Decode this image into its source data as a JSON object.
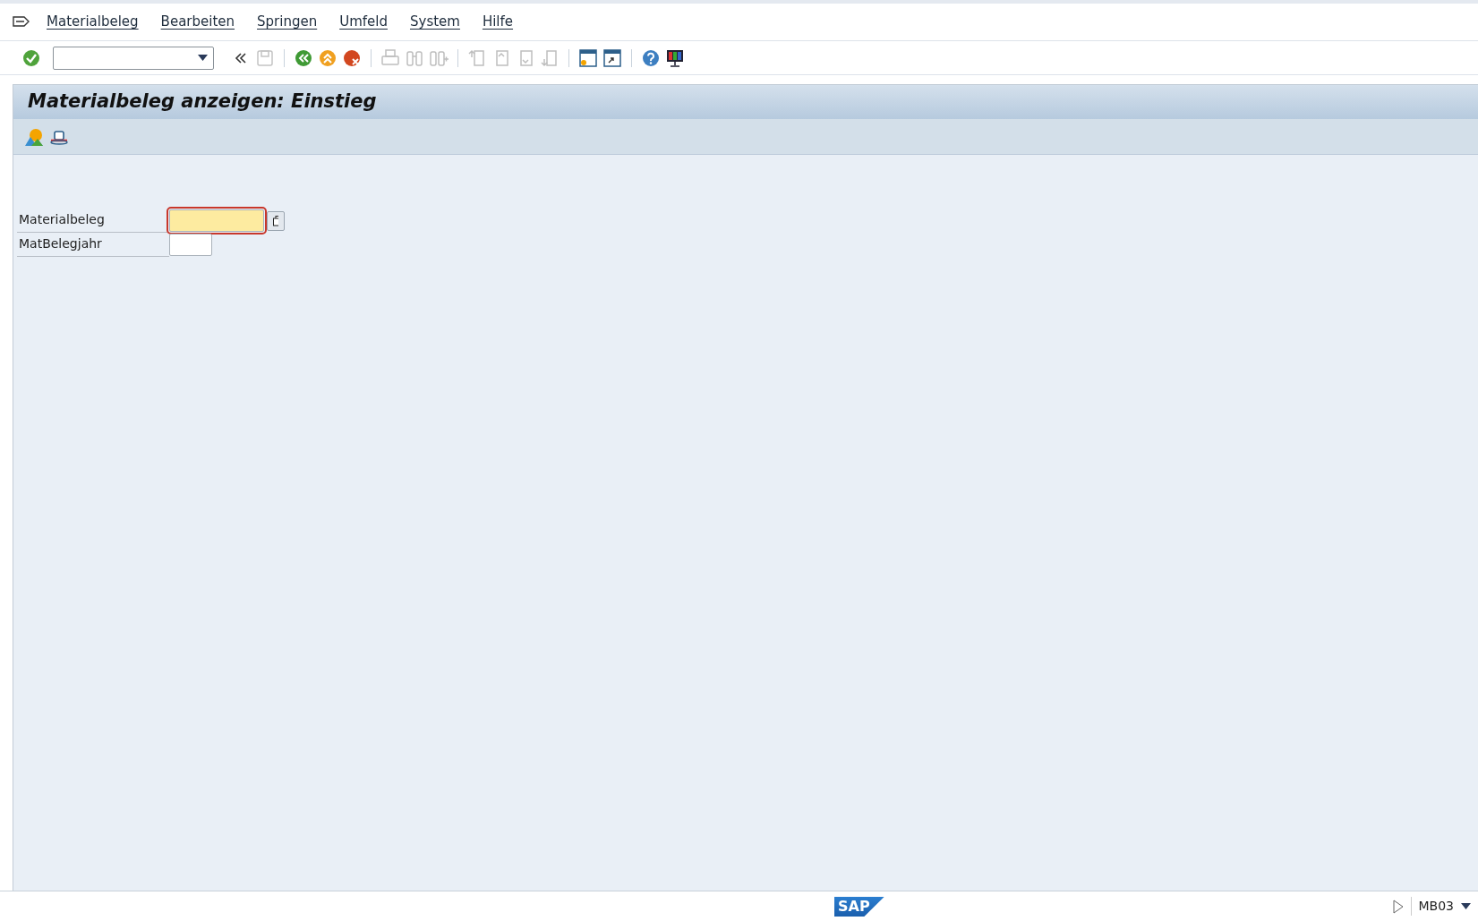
{
  "menu_bar": {
    "items": [
      "Materialbeleg",
      "Bearbeiten",
      "Springen",
      "Umfeld",
      "System",
      "Hilfe"
    ]
  },
  "toolbar": {
    "items": [
      {
        "kind": "enter",
        "disabled": false
      },
      {
        "kind": "command-field"
      },
      {
        "kind": "collapse",
        "disabled": false
      },
      {
        "kind": "save",
        "disabled": true
      },
      {
        "kind": "separator"
      },
      {
        "kind": "back",
        "disabled": false
      },
      {
        "kind": "exit",
        "disabled": false
      },
      {
        "kind": "cancel",
        "disabled": false
      },
      {
        "kind": "separator"
      },
      {
        "kind": "print",
        "disabled": true
      },
      {
        "kind": "find",
        "disabled": true
      },
      {
        "kind": "find-next",
        "disabled": true
      },
      {
        "kind": "separator"
      },
      {
        "kind": "first-page",
        "disabled": true
      },
      {
        "kind": "previous-page",
        "disabled": true
      },
      {
        "kind": "next-page",
        "disabled": true
      },
      {
        "kind": "last-page",
        "disabled": true
      },
      {
        "kind": "separator"
      },
      {
        "kind": "new-session",
        "disabled": false
      },
      {
        "kind": "shortcut",
        "disabled": false
      },
      {
        "kind": "separator"
      },
      {
        "kind": "help",
        "disabled": false
      },
      {
        "kind": "layout",
        "disabled": false
      }
    ]
  },
  "title": "Materialbeleg anzeigen: Einstieg",
  "app_toolbar": {
    "items": [
      {
        "kind": "landscape"
      },
      {
        "kind": "hat"
      }
    ]
  },
  "form": {
    "fields": [
      {
        "label": "Materialbeleg",
        "focused": true,
        "value_help": true
      },
      {
        "label": "MatBelegjahr",
        "focused": false,
        "value_help": false
      }
    ]
  },
  "status_bar": {
    "logo": "SAP",
    "transaction": "MB03"
  }
}
